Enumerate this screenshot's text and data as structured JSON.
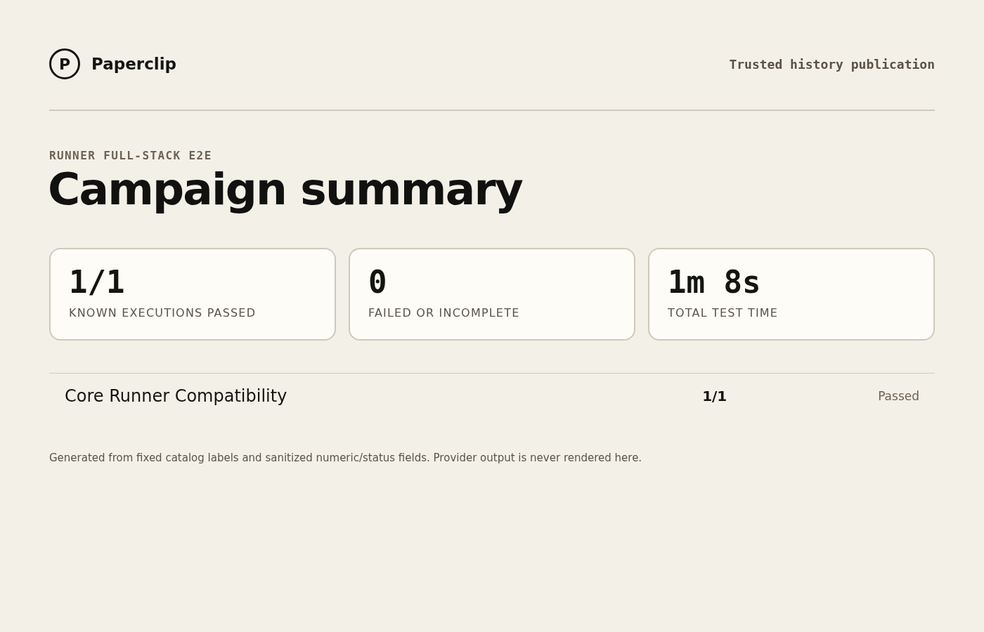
{
  "header": {
    "logo_letter": "P",
    "brand": "Paperclip",
    "tagline": "Trusted history publication"
  },
  "eyebrow": "RUNNER FULL-STACK E2E",
  "title": "Campaign summary",
  "stats": [
    {
      "value": "1/1",
      "label": "KNOWN EXECUTIONS PASSED"
    },
    {
      "value": "0",
      "label": "FAILED OR INCOMPLETE"
    },
    {
      "value": "1m 8s",
      "label": "TOTAL TEST TIME"
    }
  ],
  "suites": [
    {
      "name": "Core Runner Compatibility",
      "count": "1/1",
      "status": "Passed"
    }
  ],
  "footnote": "Generated from fixed catalog labels and sanitized numeric/status fields. Provider output is never rendered here."
}
